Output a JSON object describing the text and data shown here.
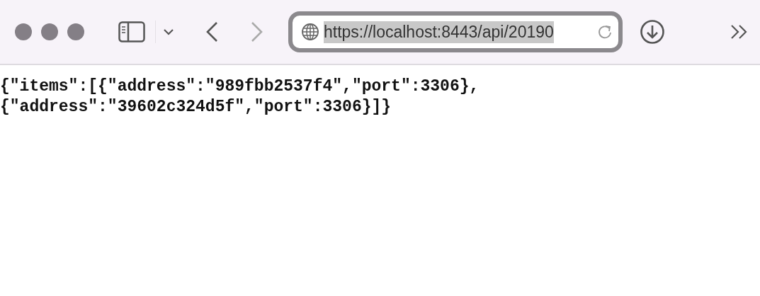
{
  "toolbar": {
    "address_bar": {
      "url": "https://localhost:8443/api/20190",
      "selected": true
    }
  },
  "content": {
    "lines": [
      "{\"items\":[{\"address\":\"989fbb2537f4\",\"port\":3306},",
      "{\"address\":\"39602c324d5f\",\"port\":3306}]}"
    ]
  }
}
